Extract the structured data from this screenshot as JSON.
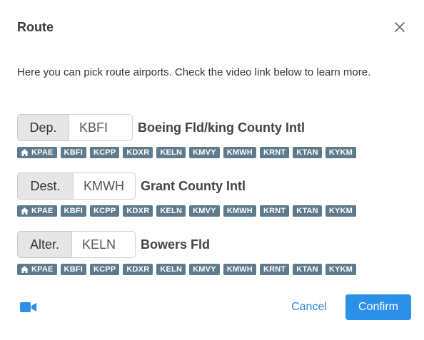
{
  "dialog": {
    "title": "Route",
    "intro": "Here you can pick route airports. Check the video link below to learn more.",
    "close_icon": "close-icon"
  },
  "route": [
    {
      "label": "Dep.",
      "code": "KBFI",
      "name": "Boeing Fld/king County Intl"
    },
    {
      "label": "Dest.",
      "code": "KMWH",
      "name": "Grant County Intl"
    },
    {
      "label": "Alter.",
      "code": "KELN",
      "name": "Bowers Fld"
    }
  ],
  "quick_airports": {
    "home_icon": "home-icon",
    "codes": [
      "KPAE",
      "KBFI",
      "KCPP",
      "KDXR",
      "KELN",
      "KMVY",
      "KMWH",
      "KRNT",
      "KTAN",
      "KYKM"
    ]
  },
  "footer": {
    "video_icon": "video-camera-icon",
    "cancel_label": "Cancel",
    "confirm_label": "Confirm"
  },
  "colors": {
    "accent": "#2b90e8",
    "chip": "#5d7b8c",
    "addon_bg": "#e6e6e6"
  }
}
